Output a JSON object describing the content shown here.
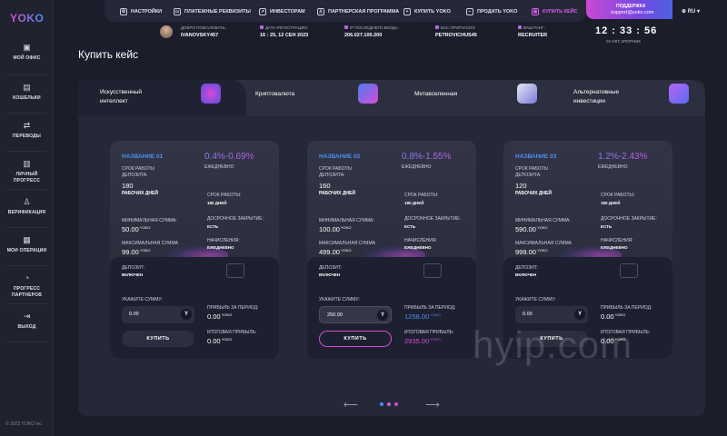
{
  "app": {
    "logo": "YOKO",
    "copyright": "© 2023 YOKO inc."
  },
  "sidebar": {
    "items": [
      {
        "label": "МОЙ ОФИС",
        "icon": "office-icon"
      },
      {
        "label": "КОШЕЛЬКИ",
        "icon": "wallet-icon"
      },
      {
        "label": "ПЕРЕВОДЫ",
        "icon": "transfer-icon"
      },
      {
        "label": "ЛИЧНЫЙ ПРОГРЕСС",
        "icon": "progress-icon"
      },
      {
        "label": "ВЕРИФИКАЦИЯ",
        "icon": "user-icon"
      },
      {
        "label": "МОИ ОПЕРАЦИИ",
        "icon": "calendar-icon"
      },
      {
        "label": "ПРОГРЕСС ПАРТНЕРОВ",
        "icon": "partners-progress-icon"
      },
      {
        "label": "ВЫХОД",
        "icon": "logout-icon"
      }
    ]
  },
  "topnav": {
    "items": [
      {
        "label": "НАСТРОЙКИ",
        "icon": "gear-icon"
      },
      {
        "label": "ПЛАТЕЖНЫЕ РЕКВИЗИТЫ",
        "icon": "card-icon"
      },
      {
        "label": "ИНВЕСТОРАМ",
        "icon": "chart-icon"
      },
      {
        "label": "ПАРТНЕРСКАЯ ПРОГРАММА",
        "icon": "people-icon"
      },
      {
        "label": "КУПИТЬ YOKO",
        "icon": "plus-icon"
      },
      {
        "label": "ПРОДАТЬ YOKO",
        "icon": "minus-icon"
      },
      {
        "label": "КУПИТЬ КЕЙС",
        "icon": "case-icon"
      }
    ],
    "active_color": "#d85cf3"
  },
  "support": {
    "title": "ПОДДЕРЖКА",
    "email": "support@yoko.com"
  },
  "language": "RU",
  "infobar": {
    "welcome_label": "ДОБРО ПОЖАЛОВАТЬ,",
    "welcome_value": "IVANOVSKY457",
    "reg_label": "ДАТА РЕГИСТРАЦИИ:",
    "reg_value": "16 : 25,  12 СЕН 2023",
    "ip_label": "IP ПОСЛЕДНЕГО ВХОДА:",
    "ip_value": "206.027.100.200",
    "invited_label": "ВАС ПРИГЛАСИЛ:",
    "invited_value": "PETROVICHUS45",
    "rank_label": "ВАШ РАНГ:",
    "rank_value": "RECRUITER"
  },
  "clock": {
    "time": "12 : 33 : 56",
    "date": "03 ОКТ, ВТОРНИК"
  },
  "page": {
    "title": "Купить кейс"
  },
  "tabs": [
    {
      "label": "Искусственный интеллект",
      "active": true
    },
    {
      "label": "Криптовалюта",
      "active": false
    },
    {
      "label": "Метавселенная",
      "active": false
    },
    {
      "label": "Альтернативные инвестиции",
      "active": false
    }
  ],
  "cards": [
    {
      "name": "НАЗВАНИЕ 01",
      "percent": "0.4%-0.69%",
      "daily": "ЕЖЕДНЕВНО",
      "term_label": "СРОК РАБОТЫ ДЕПОЗИТА:",
      "term_value": "180",
      "term_unit": "РАБОЧИХ ДНЕЙ",
      "term2_label": "СРОК РАБОТЫ:",
      "term2_value": "180 ДНЕЙ",
      "min_label": "МИНИМАЛЬНАЯ СУММА:",
      "min_value": "50.00",
      "min_unit": "YOKO",
      "early_label": "ДОСРОЧНОЕ ЗАКРЫТИЕ:",
      "early_value": "ЕСТЬ",
      "max_label": "МАКСИМАЛЬНАЯ СУММА",
      "max_value": "99.00",
      "max_unit": "YOKO",
      "accrual_label": "НАЧИСЛЕНИЯ:",
      "accrual_value": "ЕЖЕДНЕВНО",
      "deposit_label": "ДЕПОЗИТ:",
      "deposit_value": "ВКЛЮЧЕН",
      "sum_label": "УКАЖИТЕ СУММУ:",
      "sum_value": "0.00",
      "profit_label": "ПРИБЫЛЬ ЗА ПЕРИОД:",
      "profit_value": "0.00",
      "profit_unit": "YOKO",
      "total_label": "ИТОГОВАЯ ПРИБЫЛЬ:",
      "total_value": "0.00",
      "total_unit": "YOKO",
      "buy_label": "КУПИТЬ",
      "highlight": false
    },
    {
      "name": "НАЗВАНИЕ 02",
      "percent": "0.8%-1.55%",
      "daily": "ЕЖЕДНЕВНО",
      "term_label": "СРОК РАБОТЫ ДЕПОЗИТА:",
      "term_value": "160",
      "term_unit": "РАБОЧИХ ДНЕЙ",
      "term2_label": "СРОК РАБОТЫ:",
      "term2_value": "180 ДНЕЙ",
      "min_label": "МИНИМАЛЬНАЯ СУММА:",
      "min_value": "100.00",
      "min_unit": "YOKO",
      "early_label": "ДОСРОЧНОЕ ЗАКРЫТИЕ:",
      "early_value": "ЕСТЬ",
      "max_label": "МАКСИМАЛЬНАЯ СУММА",
      "max_value": "499.00",
      "max_unit": "YOKO",
      "accrual_label": "НАЧИСЛЕНИЯ:",
      "accrual_value": "ЕЖЕДНЕВНО",
      "deposit_label": "ДЕПОЗИТ:",
      "deposit_value": "ВКЛЮЧЕН",
      "sum_label": "УКАЖИТЕ СУММУ:",
      "sum_value": "250.00",
      "profit_label": "ПРИБЫЛЬ ЗА ПЕРИОД:",
      "profit_value": "1258.00",
      "profit_unit": "YOKO",
      "total_label": "ИТОГОВАЯ ПРИБЫЛЬ:",
      "total_value": "2935.00",
      "total_unit": "YOKO",
      "buy_label": "КУПИТЬ",
      "highlight": true
    },
    {
      "name": "НАЗВАНИЕ 03",
      "percent": "1.2%-2.43%",
      "daily": "ЕЖЕДНЕВНО",
      "term_label": "СРОК РАБОТЫ ДЕПОЗИТА:",
      "term_value": "120",
      "term_unit": "РАБОЧИХ ДНЕЙ",
      "term2_label": "СРОК РАБОТЫ:",
      "term2_value": "180 ДНЕЙ",
      "min_label": "МИНИМАЛЬНАЯ СУММА:",
      "min_value": "590.00",
      "min_unit": "YOKO",
      "early_label": "ДОСРОЧНОЕ ЗАКРЫТИЕ:",
      "early_value": "ЕСТЬ",
      "max_label": "МАКСИМАЛЬНАЯ СУММА",
      "max_value": "999.00",
      "max_unit": "YOKO",
      "accrual_label": "НАЧИСЛЕНИЯ:",
      "accrual_value": "ЕЖЕДНЕВНО",
      "deposit_label": "ДЕПОЗИТ:",
      "deposit_value": "ВКЛЮЧЕН",
      "sum_label": "УКАЖИТЕ СУММУ:",
      "sum_value": "0.00",
      "profit_label": "ПРИБЫЛЬ ЗА ПЕРИОД:",
      "profit_value": "0.00",
      "profit_unit": "YOKO",
      "total_label": "ИТОГОВАЯ ПРИБЫЛЬ:",
      "total_value": "0.00",
      "total_unit": "YOKO",
      "buy_label": "КУПИТЬ",
      "highlight": false
    }
  ],
  "token_symbol": "Y",
  "colors": {
    "accent_pink": "#d94bd6",
    "accent_blue": "#4e8ff5",
    "highlight_value": "#c95de6"
  },
  "watermark": "hyip.com"
}
